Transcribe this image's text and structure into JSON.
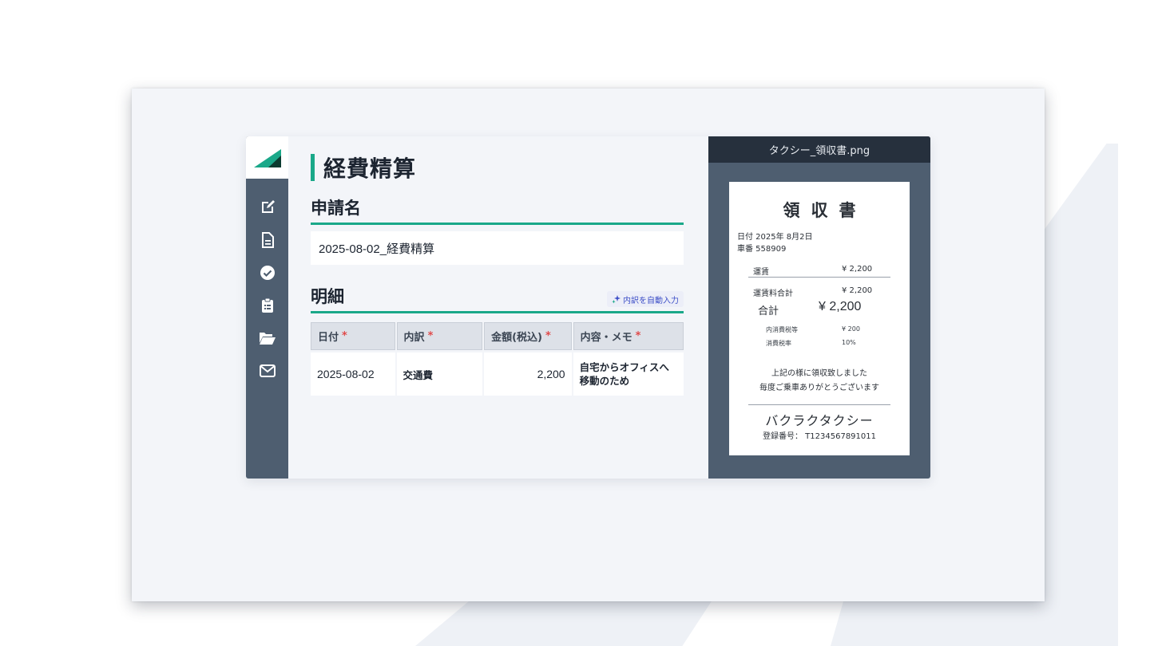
{
  "colors": {
    "accent": "#1aa889",
    "sidebar": "#4e5e70",
    "required": "#e04a4a"
  },
  "sidebar": {
    "logo": "brand-logo",
    "items": [
      {
        "icon": "edit-icon"
      },
      {
        "icon": "document-icon"
      },
      {
        "icon": "check-circle-icon"
      },
      {
        "icon": "clipboard-list-icon"
      },
      {
        "icon": "folder-open-icon"
      },
      {
        "icon": "mail-icon"
      }
    ]
  },
  "main": {
    "title": "経費精算",
    "request_name": {
      "label": "申請名",
      "value": "2025-08-02_経費精算"
    },
    "details": {
      "label": "明細",
      "auto_fill_label": "内訳を自動入力",
      "columns": [
        {
          "label": "日付",
          "required": "*"
        },
        {
          "label": "内訳",
          "required": "*"
        },
        {
          "label": "金額(税込)",
          "required": "*"
        },
        {
          "label": "内容・メモ",
          "required": "*"
        }
      ],
      "rows": [
        {
          "date": "2025-08-02",
          "category": "交通費",
          "amount": "2,200",
          "memo": "自宅からオフィスへ移動のため"
        }
      ]
    }
  },
  "preview": {
    "filename": "タクシー_領収書.png",
    "receipt": {
      "title": "領収書",
      "date_line": "日付 2025年 8月2日",
      "car_line": "車番 558909",
      "fare_label": "運賃",
      "fare_value": "¥ 2,200",
      "fare_total_label": "運賃料合計",
      "fare_total_value": "¥ 2,200",
      "total_label": "合計",
      "total_value": "¥ 2,200",
      "tax_label": "内消費税等",
      "tax_value": "¥ 200",
      "tax_rate_label": "消費税率",
      "tax_rate_value": "10%",
      "message_1": "上記の様に領収致しました",
      "message_2": "毎度ご乗車ありがとうございます",
      "company": "バクラクタクシー",
      "registration": "登録番号： T1234567891011"
    }
  }
}
